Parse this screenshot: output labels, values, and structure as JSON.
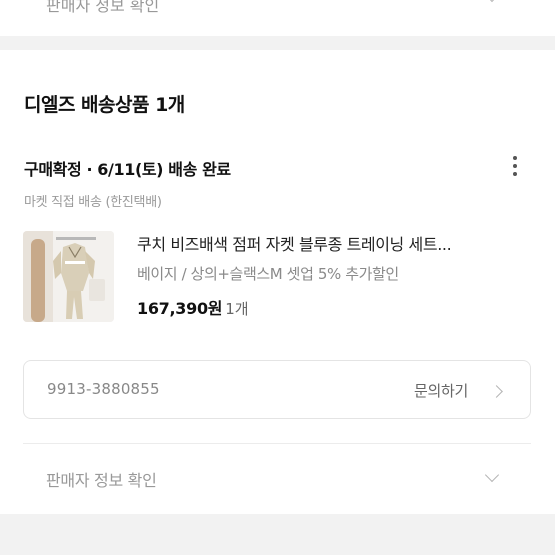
{
  "previous_section": {
    "seller_info_label": "판매자 정보 확인"
  },
  "order": {
    "seller_title": "디엘즈 배송상품 1개",
    "status_text": "구매확정 · 6/11(토) 배송 완료",
    "delivery_method": "마켓 직접 배송 (한진택배)",
    "more_icon": "more-vertical-icon",
    "product": {
      "name": "쿠치 비즈배색 점퍼 자켓 블루종 트레이닝 세트...",
      "option": "베이지 / 상의+슬랙스M 셋업 5% 추가할인",
      "price": "167,390원",
      "quantity": "1개",
      "thumbnail_icon": "product-thumbnail"
    },
    "tracking_number": "9913-3880855",
    "inquiry_label": "문의하기",
    "seller_info_label": "판매자 정보 확인"
  },
  "colors": {
    "background_gap": "#f2f2f2",
    "text_primary": "#111111",
    "text_muted": "#999999",
    "border": "#e4e4e4"
  }
}
